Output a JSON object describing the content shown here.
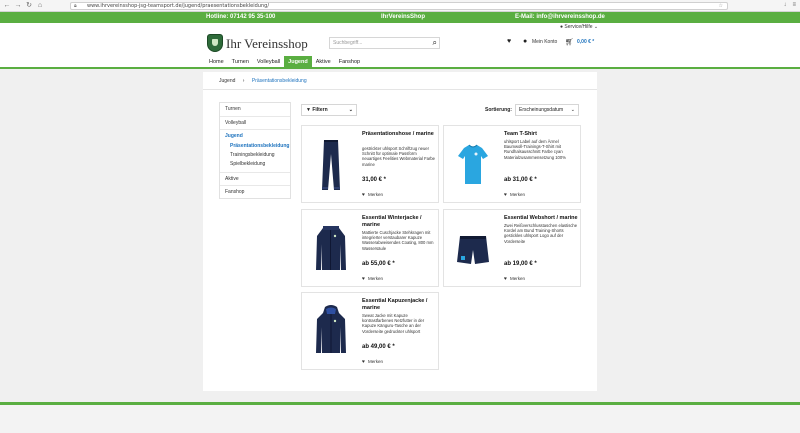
{
  "browser": {
    "url": "www.ihrvereinsshop-jsg-teamsport.de/jugend/praesentationsbekleidung/"
  },
  "topbar": {
    "hotline": "Hotline: 07142 95 35-100",
    "shop": "IhrVereinsShop",
    "email": "E-Mail: info@ihrvereinsshop.de"
  },
  "header": {
    "servicehilfe": "Service/Hilfe",
    "logo": "Ihr Vereinsshop",
    "search_placeholder": "Suchbegriff...",
    "account": "Mein Konto",
    "cart_total": "0,00 € *"
  },
  "mainnav": [
    "Home",
    "Turnen",
    "Volleyball",
    "Jugend",
    "Aktive",
    "Fanshop"
  ],
  "breadcrumb": {
    "parent": "Jugend",
    "current": "Präsentationsbekleidung"
  },
  "sidebar": {
    "items": [
      "Turnen",
      "Volleyball",
      "Jugend",
      "Aktive",
      "Fanshop"
    ],
    "subitems": [
      "Präsentationsbekleidung",
      "Trainingsbekleidung",
      "Spielbekleidung"
    ]
  },
  "toolbar": {
    "filter": "Filtern",
    "sort_label": "Sortierung:",
    "sort_value": "Erscheinungsdatum"
  },
  "products": [
    {
      "name": "Präsentationshose / marine",
      "desc": "gestrickter uhlsport Schriftzug neuer Schnitt für optimale Passform neuartiges Feelities Webmaterial Farbe marine",
      "price": "31,00 € *",
      "fav": "Merken"
    },
    {
      "name": "Team T-Shirt",
      "desc": "uhlsport Label auf dem Ärmel Baumwoll-Trainings-T-Shirt mit Rundhalsausschnitt Farbe cyan Materialzusammensetzung 100%",
      "price": "ab 31,00 € *",
      "fav": "Merken"
    },
    {
      "name": "Essential Winterjacke / marine",
      "desc": "Mattierte Cuschjacke Stehkragen mit integrierter verstaubarer Kapuze Wasserabweisendes Coating, 800 mm Wassersäule",
      "price": "ab 55,00 € *",
      "fav": "Merken"
    },
    {
      "name": "Essential Webshort / marine",
      "desc": "Zwei Reißverschlusstaschen elastische Kordel am Bund Training-Shorts gestickles uhlsport Logo auf der Vorderseite",
      "price": "ab 19,00 € *",
      "fav": "Merken"
    },
    {
      "name": "Essential Kapuzenjacke / marine",
      "desc": "Sweat Jacke mit Kapuze kontrastfarbenes Netzfutter in der Kapuze Känguru-Tasche an der Vorderseite gedruckter uhlsport",
      "price": "ab 49,00 € *",
      "fav": "Merken"
    }
  ],
  "colors": {
    "brand_green": "#5aae41",
    "link_blue": "#1e73be",
    "navy": "#1d2a4d",
    "cyan": "#2aa6e0"
  }
}
